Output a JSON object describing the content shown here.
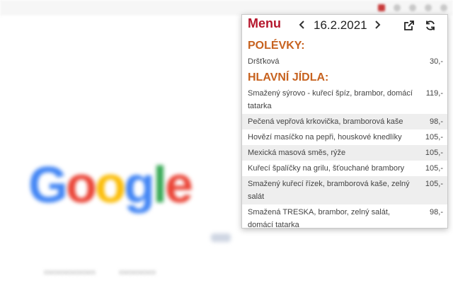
{
  "popup": {
    "title": "Menu",
    "date": "16.2.2021",
    "colors": {
      "title": "#b5172d",
      "section": "#c7621f"
    },
    "icons": {
      "prev": "chevron-left-icon",
      "next": "chevron-right-icon",
      "open": "open-external-icon",
      "refresh": "refresh-icon"
    },
    "sections": [
      {
        "title": "POLÉVKY:",
        "items": [
          {
            "name": "Dršťková",
            "price": "30,-"
          }
        ]
      },
      {
        "title": "HLAVNÍ JÍDLA:",
        "items": [
          {
            "name": "Smažený sýrovo - kuřecí špíz, brambor, domácí tatarka",
            "price": "119,-"
          },
          {
            "name": "Pečená vepřová krkovička, bramborová kaše",
            "price": "98,-"
          },
          {
            "name": "Hovězí masíčko na pepři, houskové knedlíky",
            "price": "105,-"
          },
          {
            "name": "Mexická masová směs, rýže",
            "price": "105,-"
          },
          {
            "name": "Kuřecí špalíčky na grilu, šťouchané brambory",
            "price": "105,-"
          },
          {
            "name": "Smažený kuřecí řízek, bramborová kaše, zelný salát",
            "price": "105,-"
          },
          {
            "name": "Smažená TRESKA, brambor, zelný salát, domácí tatarka",
            "price": "98,-"
          }
        ]
      }
    ]
  }
}
